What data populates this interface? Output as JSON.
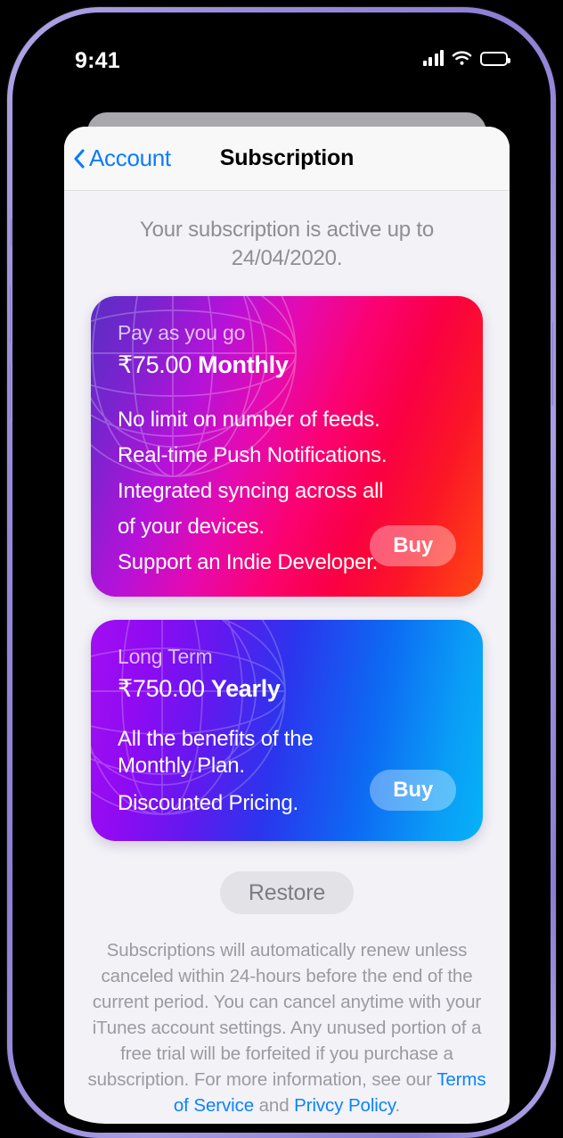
{
  "device": {
    "statusbar": {
      "time": "9:41",
      "cellular_icon": "cellular-signal-icon",
      "wifi_icon": "wifi-icon",
      "battery_icon": "battery-full-icon"
    }
  },
  "navbar": {
    "back_icon": "chevron-left-icon",
    "back_label": "Account",
    "title": "Subscription"
  },
  "status_message": "Your subscription is active up to 24/04/2020.",
  "plans": [
    {
      "kicker": "Pay as you go",
      "price": "₹75.00",
      "period": "Monthly",
      "features": [
        "No limit on number of feeds.",
        "Real-time Push Notifications.",
        "Integrated syncing across all",
        "of your devices.",
        "Support an Indie Developer."
      ],
      "buy_label": "Buy",
      "gradient_from": "#5a2ec4",
      "gradient_mid": "#fb0273",
      "gradient_to": "#ff4a12"
    },
    {
      "kicker": "Long Term",
      "price": "₹750.00",
      "period": "Yearly",
      "features": [
        "All the benefits of the",
        "Monthly Plan.",
        "Discounted Pricing."
      ],
      "buy_label": "Buy",
      "gradient_from": "#a20ef2",
      "gradient_mid": "#2b35ed",
      "gradient_to": "#06b2f8"
    }
  ],
  "restore_label": "Restore",
  "footer": {
    "text_1": "Subscriptions will automatically renew unless canceled within 24-hours before the end of the current period. You can cancel anytime with your iTunes account settings. Any unused portion of a free trial will be forfeited if you purchase a subscription. For more information, see our ",
    "terms_link": "Terms of Service",
    "text_2": " and ",
    "privacy_link": "Privcy Policy",
    "text_3": "."
  },
  "colors": {
    "accent_blue": "#0a84ff",
    "sheet_background": "#f2f2f7",
    "muted_text": "#8e8e93",
    "frame": "#9b8ddc"
  }
}
